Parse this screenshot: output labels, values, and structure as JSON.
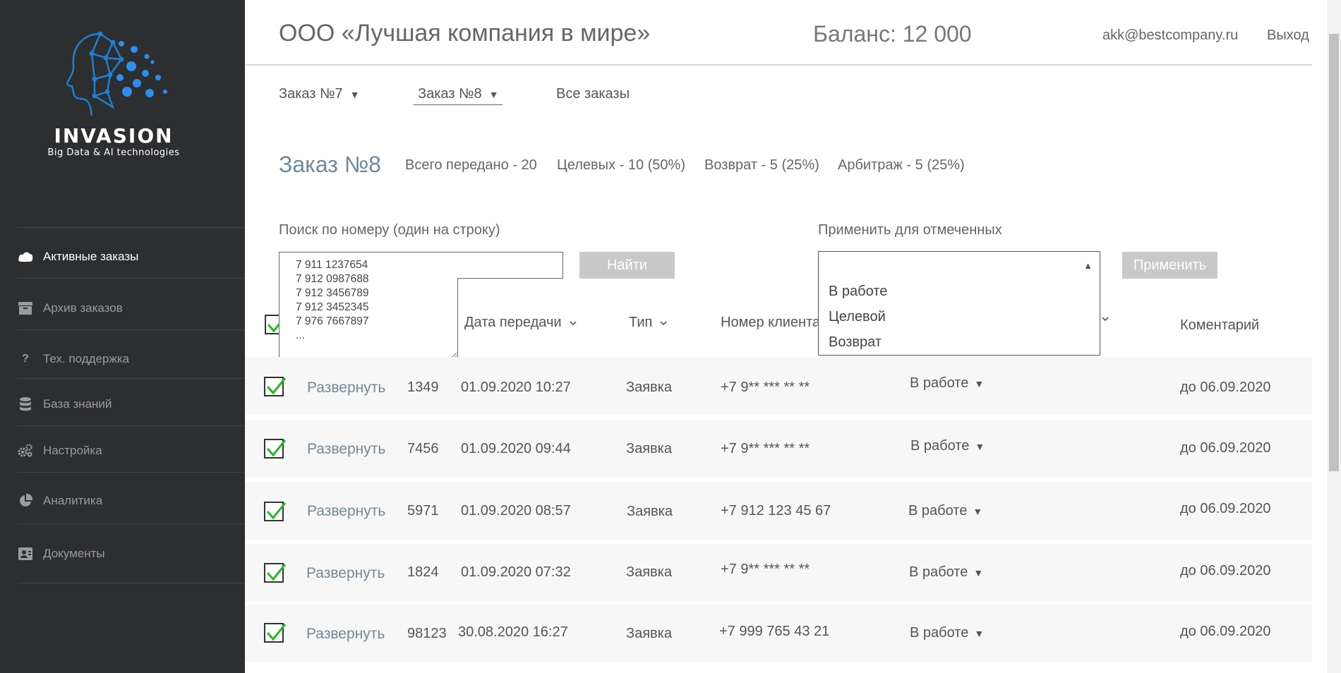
{
  "brand": {
    "name": "INVASION",
    "tagline": "Big Data & AI technologies"
  },
  "sidebar": {
    "items": [
      {
        "label": "Активные заказы",
        "icon": "cloud-icon",
        "active": true
      },
      {
        "label": "Архив заказов",
        "icon": "archive-icon",
        "active": false
      },
      {
        "label": "Тех. поддержка",
        "icon": "question-icon",
        "active": false
      },
      {
        "label": "База знаний",
        "icon": "database-icon",
        "active": false
      },
      {
        "label": "Настройка",
        "icon": "gears-icon",
        "active": false
      },
      {
        "label": "Аналитика",
        "icon": "pie-chart-icon",
        "active": false
      },
      {
        "label": "Документы",
        "icon": "contact-card-icon",
        "active": false
      }
    ]
  },
  "header": {
    "company": "ООО «Лучшая компания в мире»",
    "balance": "Баланс: 12 000",
    "email": "akk@bestcompany.ru",
    "logout": "Выход"
  },
  "orders_nav": {
    "tabs": [
      {
        "label": "Заказ №7",
        "selected": false
      },
      {
        "label": "Заказ №8",
        "selected": true
      }
    ],
    "all_orders": "Все заказы"
  },
  "order": {
    "title": "Заказ №8",
    "stats": {
      "total": "Всего передано - 20",
      "target": "Целевых - 10 (50%)",
      "returned": "Возврат - 5 (25%)",
      "arbitration": "Арбитраж - 5 (25%)"
    }
  },
  "search": {
    "label": "Поиск по номеру (один на строку)",
    "lines": [
      "7 911 1237654",
      "7 912 0987688",
      "7 912 3456789",
      "7 912 3452345",
      "7 976 7667897",
      "..."
    ],
    "button": "Найти"
  },
  "apply": {
    "label": "Применить для отмеченных",
    "options": [
      "В работе",
      "Целевой",
      "Возврат"
    ],
    "button": "Применить"
  },
  "table": {
    "headers": {
      "date": "Дата передачи",
      "type": "Тип",
      "client": "Номер клиента",
      "comment": "Коментарий"
    },
    "rows": [
      {
        "expand": "Развернуть",
        "id": "1349",
        "date": "01.09.2020 10:27",
        "type": "Заявка",
        "phone": "+7 9** *** ** **",
        "status": "В работе",
        "comment": "до 06.09.2020"
      },
      {
        "expand": "Развернуть",
        "id": "7456",
        "date": "01.09.2020 09:44",
        "type": "Заявка",
        "phone": "+7 9** *** ** **",
        "status": "В работе",
        "comment": "до 06.09.2020"
      },
      {
        "expand": "Развернуть",
        "id": "5971",
        "date": "01.09.2020 08:57",
        "type": "Заявка",
        "phone": "+7 912 123 45 67",
        "status": "В работе",
        "comment": "до 06.09.2020"
      },
      {
        "expand": "Развернуть",
        "id": "1824",
        "date": "01.09.2020 07:32",
        "type": "Заявка",
        "phone": "+7 9** *** ** **",
        "status": "В работе",
        "comment": "до 06.09.2020"
      },
      {
        "expand": "Развернуть",
        "id": "98123",
        "date": "30.08.2020 16:27",
        "type": "Заявка",
        "phone": "+7 999 765 43 21",
        "status": "В работе",
        "comment": "до 06.09.2020"
      }
    ]
  },
  "colors": {
    "sidebar_bg": "#2d2e30",
    "accent": "#6f8a99",
    "check_green": "#22bb22",
    "button_gray": "#c9c9c9"
  }
}
